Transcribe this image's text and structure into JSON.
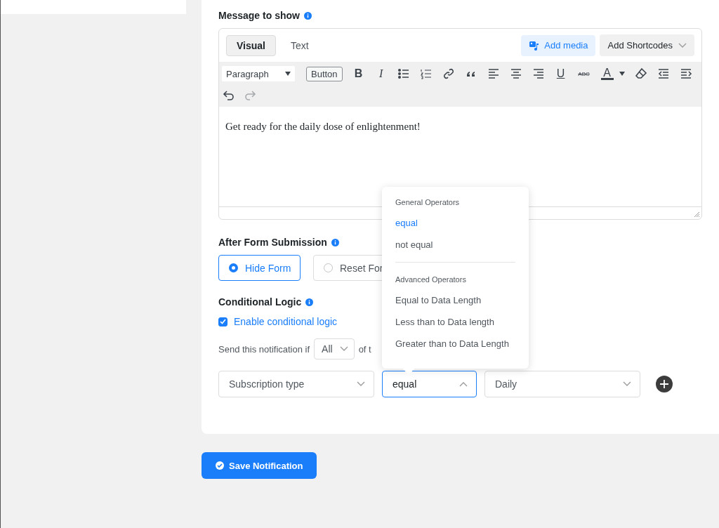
{
  "message_section": {
    "title": "Message to show"
  },
  "editor": {
    "tabs": [
      {
        "label": "Visual",
        "selected": true
      },
      {
        "label": "Text",
        "selected": false
      }
    ],
    "add_media": "Add media",
    "add_shortcodes": "Add Shortcodes",
    "format_select": "Paragraph",
    "button_label": "Button",
    "toolbar": [
      {
        "kind": "char",
        "text": "B"
      },
      {
        "kind": "char",
        "text": "I"
      },
      {
        "kind": "icon"
      },
      {
        "kind": "icon"
      },
      {
        "kind": "icon"
      },
      {
        "kind": "icon"
      },
      {
        "kind": "icon"
      },
      {
        "kind": "icon"
      },
      {
        "kind": "icon"
      },
      {
        "kind": "char",
        "text": "U"
      },
      {
        "kind": "char",
        "text": "ABC"
      },
      {
        "kind": "char",
        "text": "A"
      },
      {
        "kind": "icon"
      },
      {
        "kind": "icon"
      },
      {
        "kind": "icon"
      },
      {
        "kind": "icon"
      },
      {
        "kind": "icon"
      },
      {
        "kind": "icon"
      }
    ],
    "content": "Get ready for the daily dose of enlightenment!"
  },
  "after_submission": {
    "title": "After Form Submission",
    "options": [
      {
        "label": "Hide Form",
        "selected": true
      },
      {
        "label": "Reset For",
        "selected": false
      }
    ]
  },
  "conditional": {
    "title": "Conditional Logic",
    "enable": {
      "label": "Enable conditional logic",
      "checked": true
    },
    "send_prefix": "Send this notification if",
    "match": "All",
    "send_suffix": "of t",
    "rule": {
      "field": "Subscription type",
      "operator": "equal",
      "value": "Daily"
    }
  },
  "operator_menu": {
    "groups": [
      {
        "title": "General Operators",
        "items": [
          {
            "label": "equal",
            "selected": true
          },
          {
            "label": "not equal",
            "selected": false
          }
        ]
      },
      {
        "title": "Advanced Operators",
        "items": [
          {
            "label": "Equal to Data Length",
            "selected": false
          },
          {
            "label": "Less than to Data length",
            "selected": false
          },
          {
            "label": "Greater than to Data Length",
            "selected": false
          }
        ]
      }
    ]
  },
  "save_button": "Save Notification"
}
